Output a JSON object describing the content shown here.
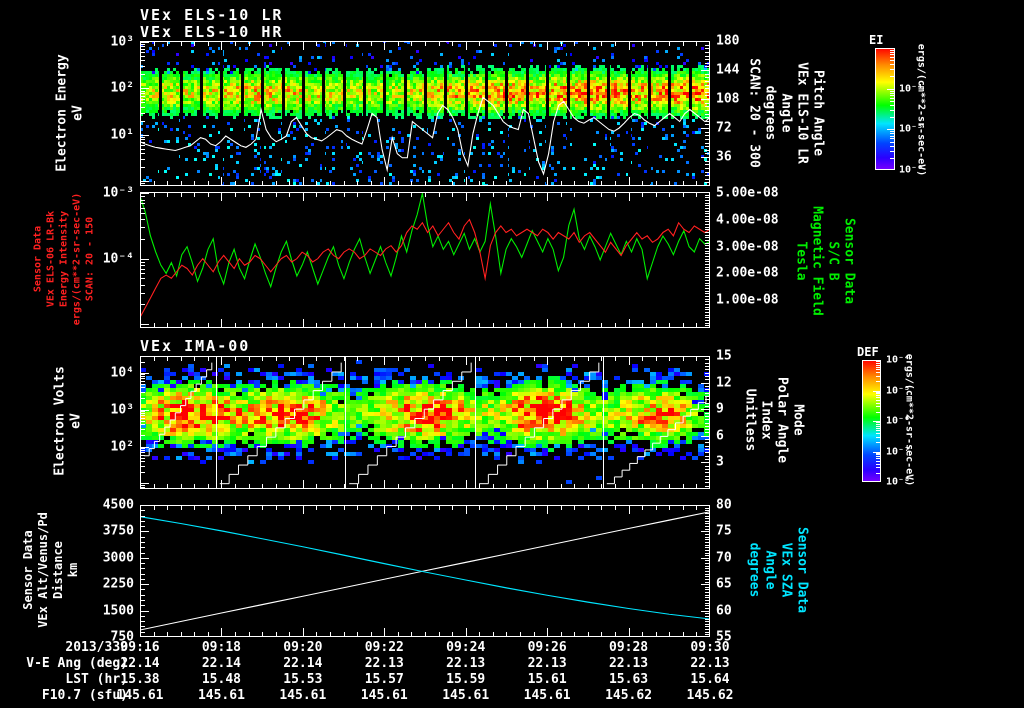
{
  "titles": {
    "els_line1": "VEx ELS-10 LR",
    "els_line2": "VEx ELS-10 HR",
    "ima": "VEx IMA-00"
  },
  "colors": {
    "background": "#000000",
    "frame": "#ffffff",
    "intensity_trace": "#ff2020",
    "bfield_trace": "#00ee00",
    "altitude_trace": "#ffffff",
    "sza_trace": "#00e5ff",
    "pitch_trace": "#ffffff"
  },
  "axis_labels": {
    "p1_left": [
      "Electron Energy",
      "eV"
    ],
    "p1_right": [
      "SCAN: 20 - 300",
      "degrees",
      "Angle",
      "VEx ELS-10 LR",
      "Pitch Angle"
    ],
    "p2_left": [
      "Sensor Data",
      "VEx ELS-06 LR-Bk",
      "Energy Intensity",
      "ergs/(cm**2-sr-sec-eV)",
      "SCAN: 20 - 150"
    ],
    "p2_right": [
      "Tesla",
      "Magnetic Field",
      "S/C B",
      "Sensor Data"
    ],
    "p3_left": [
      "Electron Volts",
      "eV"
    ],
    "p3_right": [
      "Unitless",
      "Index",
      "Polar Angle",
      "Mode"
    ],
    "p4_left": [
      "Sensor Data",
      "VEx Alt/Venus/Pd",
      "Distance",
      "km"
    ],
    "p4_right": [
      "degrees",
      "Angle",
      "VEx SZA",
      "Sensor Data"
    ]
  },
  "ticks": {
    "p1_left": [
      "10³",
      "10²",
      "10¹"
    ],
    "p1_right": [
      "180",
      "144",
      "108",
      "72",
      "36"
    ],
    "p2_left": [
      "10⁻³",
      "10⁻⁴"
    ],
    "p2_right": [
      "5.00e-08",
      "4.00e-08",
      "3.00e-08",
      "2.00e-08",
      "1.00e-08"
    ],
    "p3_left": [
      "10⁴",
      "10³",
      "10²"
    ],
    "p3_right": [
      "15",
      "12",
      "9",
      "6",
      "3"
    ],
    "p4_left": [
      "4500",
      "3750",
      "3000",
      "2250",
      "1500",
      "750"
    ],
    "p4_right": [
      "80",
      "75",
      "70",
      "65",
      "60",
      "55"
    ]
  },
  "colorbars": [
    {
      "title": "EI",
      "units": "ergs/(cm**2-sr-sec-eV)",
      "tick_labels": [
        "10⁻⁴",
        "10⁻⁵",
        "10⁻⁶"
      ],
      "tick_exponents": [
        -4,
        -5,
        -6
      ],
      "scale_top_exp": -3,
      "scale_bottom_exp": -6
    },
    {
      "title": "DEF",
      "units": "ergs/(cm**2-sr-sec-eV)",
      "tick_labels": [
        "10⁻⁴",
        "10⁻⁵",
        "10⁻⁶",
        "10⁻⁷",
        "10⁻⁸"
      ],
      "tick_exponents": [
        -4,
        -5,
        -6,
        -7,
        -8
      ],
      "scale_top_exp": -4,
      "scale_bottom_exp": -8
    }
  ],
  "table": {
    "row_labels": [
      "2013/339",
      "V-E Ang (deg)",
      "LST (hr)",
      "F10.7 (sfu)"
    ],
    "times": [
      "09:16",
      "09:18",
      "09:20",
      "09:22",
      "09:24",
      "09:26",
      "09:28",
      "09:30"
    ],
    "rows": [
      [
        "22.14",
        "22.14",
        "22.14",
        "22.13",
        "22.13",
        "22.13",
        "22.13",
        "22.13"
      ],
      [
        "15.38",
        "15.48",
        "15.53",
        "15.57",
        "15.59",
        "15.61",
        "15.63",
        "15.64"
      ],
      [
        "145.61",
        "145.61",
        "145.61",
        "145.61",
        "145.61",
        "145.61",
        "145.62",
        "145.62"
      ]
    ]
  },
  "chart_data": [
    {
      "id": "els_pitch_spectrogram",
      "type": "heatmap",
      "title": "VEx ELS-10 LR / VEx ELS-10 HR",
      "x_axis": {
        "start": "09:16",
        "end": "09:30",
        "major_tick_minutes": 2
      },
      "y_left": {
        "label": "Electron Energy (eV)",
        "scale": "log",
        "tick_values": [
          1000,
          100,
          10
        ]
      },
      "y_right": {
        "label": "Pitch Angle, VEx ELS-10 LR, Angle, degrees, SCAN: 20 - 300",
        "range": [
          0,
          180
        ],
        "tick_values": [
          180,
          144,
          108,
          72,
          36
        ]
      },
      "colorbar": {
        "title": "EI",
        "units": "ergs/(cm**2-sr-sec-eV)",
        "tick_exponents": [
          -4,
          -5,
          -6
        ]
      },
      "n_scans": 28,
      "band_center_frac": 0.36,
      "band_sigma_frac": 0.11,
      "seed": 13,
      "intensity_profile": [
        0.6,
        0.65,
        0.62,
        0.68,
        0.74,
        0.7,
        0.66,
        0.62,
        0.6,
        0.64,
        0.72,
        0.76,
        0.8,
        0.76,
        0.8,
        0.84,
        0.8,
        0.76,
        0.84,
        0.88
      ],
      "pitch_angle_trace_deg": [
        55,
        52,
        50,
        48,
        47,
        46,
        45,
        44,
        46,
        48,
        50,
        55,
        60,
        58,
        52,
        50,
        55,
        62,
        58,
        54,
        50,
        48,
        52,
        58,
        95,
        70,
        60,
        55,
        58,
        62,
        80,
        85,
        75,
        65,
        60,
        58,
        56,
        60,
        65,
        70,
        68,
        62,
        58,
        55,
        52,
        70,
        90,
        85,
        45,
        20,
        60,
        40,
        35,
        35,
        80,
        75,
        70,
        65,
        60,
        90,
        100,
        95,
        85,
        70,
        40,
        25,
        65,
        90,
        110,
        105,
        100,
        90,
        80,
        75,
        72,
        70,
        95,
        90,
        60,
        30,
        15,
        40,
        80,
        100,
        105,
        95,
        85,
        80,
        78,
        82,
        85,
        80,
        75,
        70,
        68,
        72,
        78,
        85,
        90,
        88,
        82,
        78,
        75,
        80,
        85,
        90,
        85,
        80,
        90,
        95,
        90,
        85,
        80,
        85
      ]
    },
    {
      "id": "intensity_and_bfield",
      "type": "line",
      "y_left": {
        "label": "VEx ELS-06 LR-Bk Energy Intensity ergs/(cm**2-sr-sec-eV) SCAN: 20 - 150",
        "scale": "log",
        "range_exp": [
          -3,
          -5
        ]
      },
      "y_right": {
        "label": "S/C B Magnetic Field (Tesla)",
        "range": [
          0,
          5e-08
        ],
        "tick_values": [
          5e-08,
          4e-08,
          3e-08,
          2e-08,
          1e-08
        ]
      },
      "series": [
        {
          "name": "energy_intensity_log10",
          "color": "#ff2020",
          "axis": "left",
          "values": [
            -4.9,
            -4.75,
            -4.6,
            -4.45,
            -4.3,
            -4.25,
            -4.3,
            -4.2,
            -4.1,
            -4.15,
            -4.25,
            -4.1,
            -4.0,
            -4.1,
            -4.2,
            -4.05,
            -3.95,
            -4.05,
            -4.15,
            -4.0,
            -4.1,
            -4.05,
            -3.95,
            -4.0,
            -4.1,
            -4.2,
            -4.1,
            -4.0,
            -3.95,
            -4.05,
            -4.0,
            -3.9,
            -3.95,
            -4.05,
            -4.0,
            -3.9,
            -3.85,
            -3.95,
            -4.0,
            -3.9,
            -3.85,
            -3.9,
            -4.0,
            -3.95,
            -3.85,
            -3.9,
            -3.95,
            -3.85,
            -3.8,
            -3.9,
            -3.8,
            -3.6,
            -3.5,
            -3.55,
            -3.45,
            -3.6,
            -3.5,
            -3.65,
            -3.55,
            -3.45,
            -3.6,
            -3.7,
            -3.5,
            -3.4,
            -3.6,
            -3.9,
            -4.3,
            -3.8,
            -3.6,
            -3.5,
            -3.6,
            -3.55,
            -3.65,
            -3.6,
            -3.55,
            -3.6,
            -3.65,
            -3.55,
            -3.6,
            -3.7,
            -3.6,
            -3.65,
            -3.7,
            -3.6,
            -3.75,
            -3.65,
            -3.6,
            -3.7,
            -3.8,
            -3.9,
            -3.75,
            -3.85,
            -3.95,
            -3.8,
            -3.7,
            -3.6,
            -3.7,
            -3.65,
            -3.75,
            -3.7,
            -3.6,
            -3.55,
            -3.65,
            -3.45,
            -3.55,
            -3.6,
            -3.5,
            -3.55,
            -3.6,
            -3.55
          ]
        },
        {
          "name": "b_field_1e-8_tesla",
          "color": "#00ee00",
          "axis": "right",
          "values": [
            4.9,
            4.3,
            3.4,
            2.8,
            2.3,
            2.0,
            2.4,
            1.9,
            2.7,
            3.0,
            2.4,
            1.7,
            2.2,
            2.9,
            3.3,
            2.1,
            1.6,
            2.4,
            2.9,
            2.2,
            1.8,
            2.5,
            3.1,
            2.6,
            2.0,
            1.5,
            2.2,
            2.8,
            3.2,
            2.5,
            1.9,
            2.3,
            2.8,
            2.2,
            1.6,
            2.1,
            2.6,
            3.0,
            2.3,
            1.8,
            2.4,
            2.9,
            3.3,
            2.6,
            2.0,
            2.5,
            3.0,
            2.4,
            1.9,
            2.6,
            3.4,
            2.8,
            3.6,
            4.2,
            5.0,
            3.8,
            3.0,
            3.4,
            2.9,
            3.2,
            2.7,
            3.1,
            3.5,
            2.9,
            3.3,
            2.8,
            3.2,
            4.6,
            3.4,
            2.0,
            2.9,
            3.3,
            3.0,
            2.6,
            3.1,
            3.6,
            3.2,
            2.8,
            3.3,
            2.9,
            2.1,
            2.6,
            3.8,
            4.4,
            3.3,
            2.9,
            3.4,
            3.0,
            2.5,
            3.0,
            3.5,
            3.1,
            2.7,
            3.2,
            2.8,
            3.3,
            2.9,
            1.8,
            2.4,
            3.0,
            3.4,
            3.1,
            2.7,
            3.2,
            3.6,
            3.0,
            2.8,
            3.3,
            3.1,
            3.2
          ]
        }
      ]
    },
    {
      "id": "ima_spectrogram",
      "type": "heatmap",
      "title": "VEx IMA-00",
      "y_left": {
        "label": "Electron Volts (eV)",
        "scale": "log",
        "tick_values": [
          10000,
          1000,
          100
        ]
      },
      "y_right": {
        "label": "Mode, Polar Angle, Index, Unitless",
        "range": [
          0,
          15
        ],
        "tick_values": [
          15,
          12,
          9,
          6,
          3
        ]
      },
      "colorbar": {
        "title": "DEF",
        "units": "ergs/(cm**2-sr-sec-eV)",
        "tick_exponents": [
          -4,
          -5,
          -6,
          -7,
          -8
        ]
      },
      "seed": 29,
      "y_center_frac": 0.44,
      "y_sigma_frac": 0.16,
      "blobs": [
        {
          "x": 0.085,
          "sx": 0.075,
          "peak": 0.97
        },
        {
          "x": 0.275,
          "sx": 0.065,
          "peak": 0.85
        },
        {
          "x": 0.5,
          "sx": 0.075,
          "peak": 0.93
        },
        {
          "x": 0.71,
          "sx": 0.062,
          "peak": 0.97
        },
        {
          "x": 0.91,
          "sx": 0.07,
          "peak": 0.8
        }
      ],
      "scan_boundaries_frac": [
        0.133,
        0.36,
        0.588,
        0.812
      ],
      "staircases": [
        [
          0.0,
          0.133,
          0.75,
          0.05
        ],
        [
          0.133,
          0.36,
          0.96,
          0.05
        ],
        [
          0.36,
          0.588,
          0.96,
          0.05
        ],
        [
          0.588,
          0.812,
          0.96,
          0.05
        ],
        [
          0.812,
          1.0,
          0.96,
          0.3
        ]
      ]
    },
    {
      "id": "altitude_and_sza",
      "type": "line",
      "y_left": {
        "label": "VEx Alt/Venus/Pd Distance (km)",
        "range": [
          750,
          4500
        ],
        "tick_values": [
          4500,
          3750,
          3000,
          2250,
          1500,
          750
        ]
      },
      "y_right": {
        "label": "VEx SZA (degrees)",
        "range": [
          55,
          80
        ],
        "tick_values": [
          80,
          75,
          70,
          65,
          60,
          55
        ]
      },
      "series": [
        {
          "name": "altitude_km",
          "color": "#ffffff",
          "axis": "left",
          "values": [
            950,
            1190,
            1430,
            1670,
            1910,
            2150,
            2390,
            2630,
            2870,
            3110,
            3350,
            3590,
            3830,
            4070,
            4310
          ]
        },
        {
          "name": "sza_deg",
          "color": "#00e5ff",
          "axis": "right",
          "values": [
            77.8,
            76.5,
            75.1,
            73.6,
            72.1,
            70.5,
            68.9,
            67.3,
            65.8,
            64.3,
            62.9,
            61.6,
            60.4,
            59.3,
            58.4
          ]
        }
      ]
    }
  ]
}
